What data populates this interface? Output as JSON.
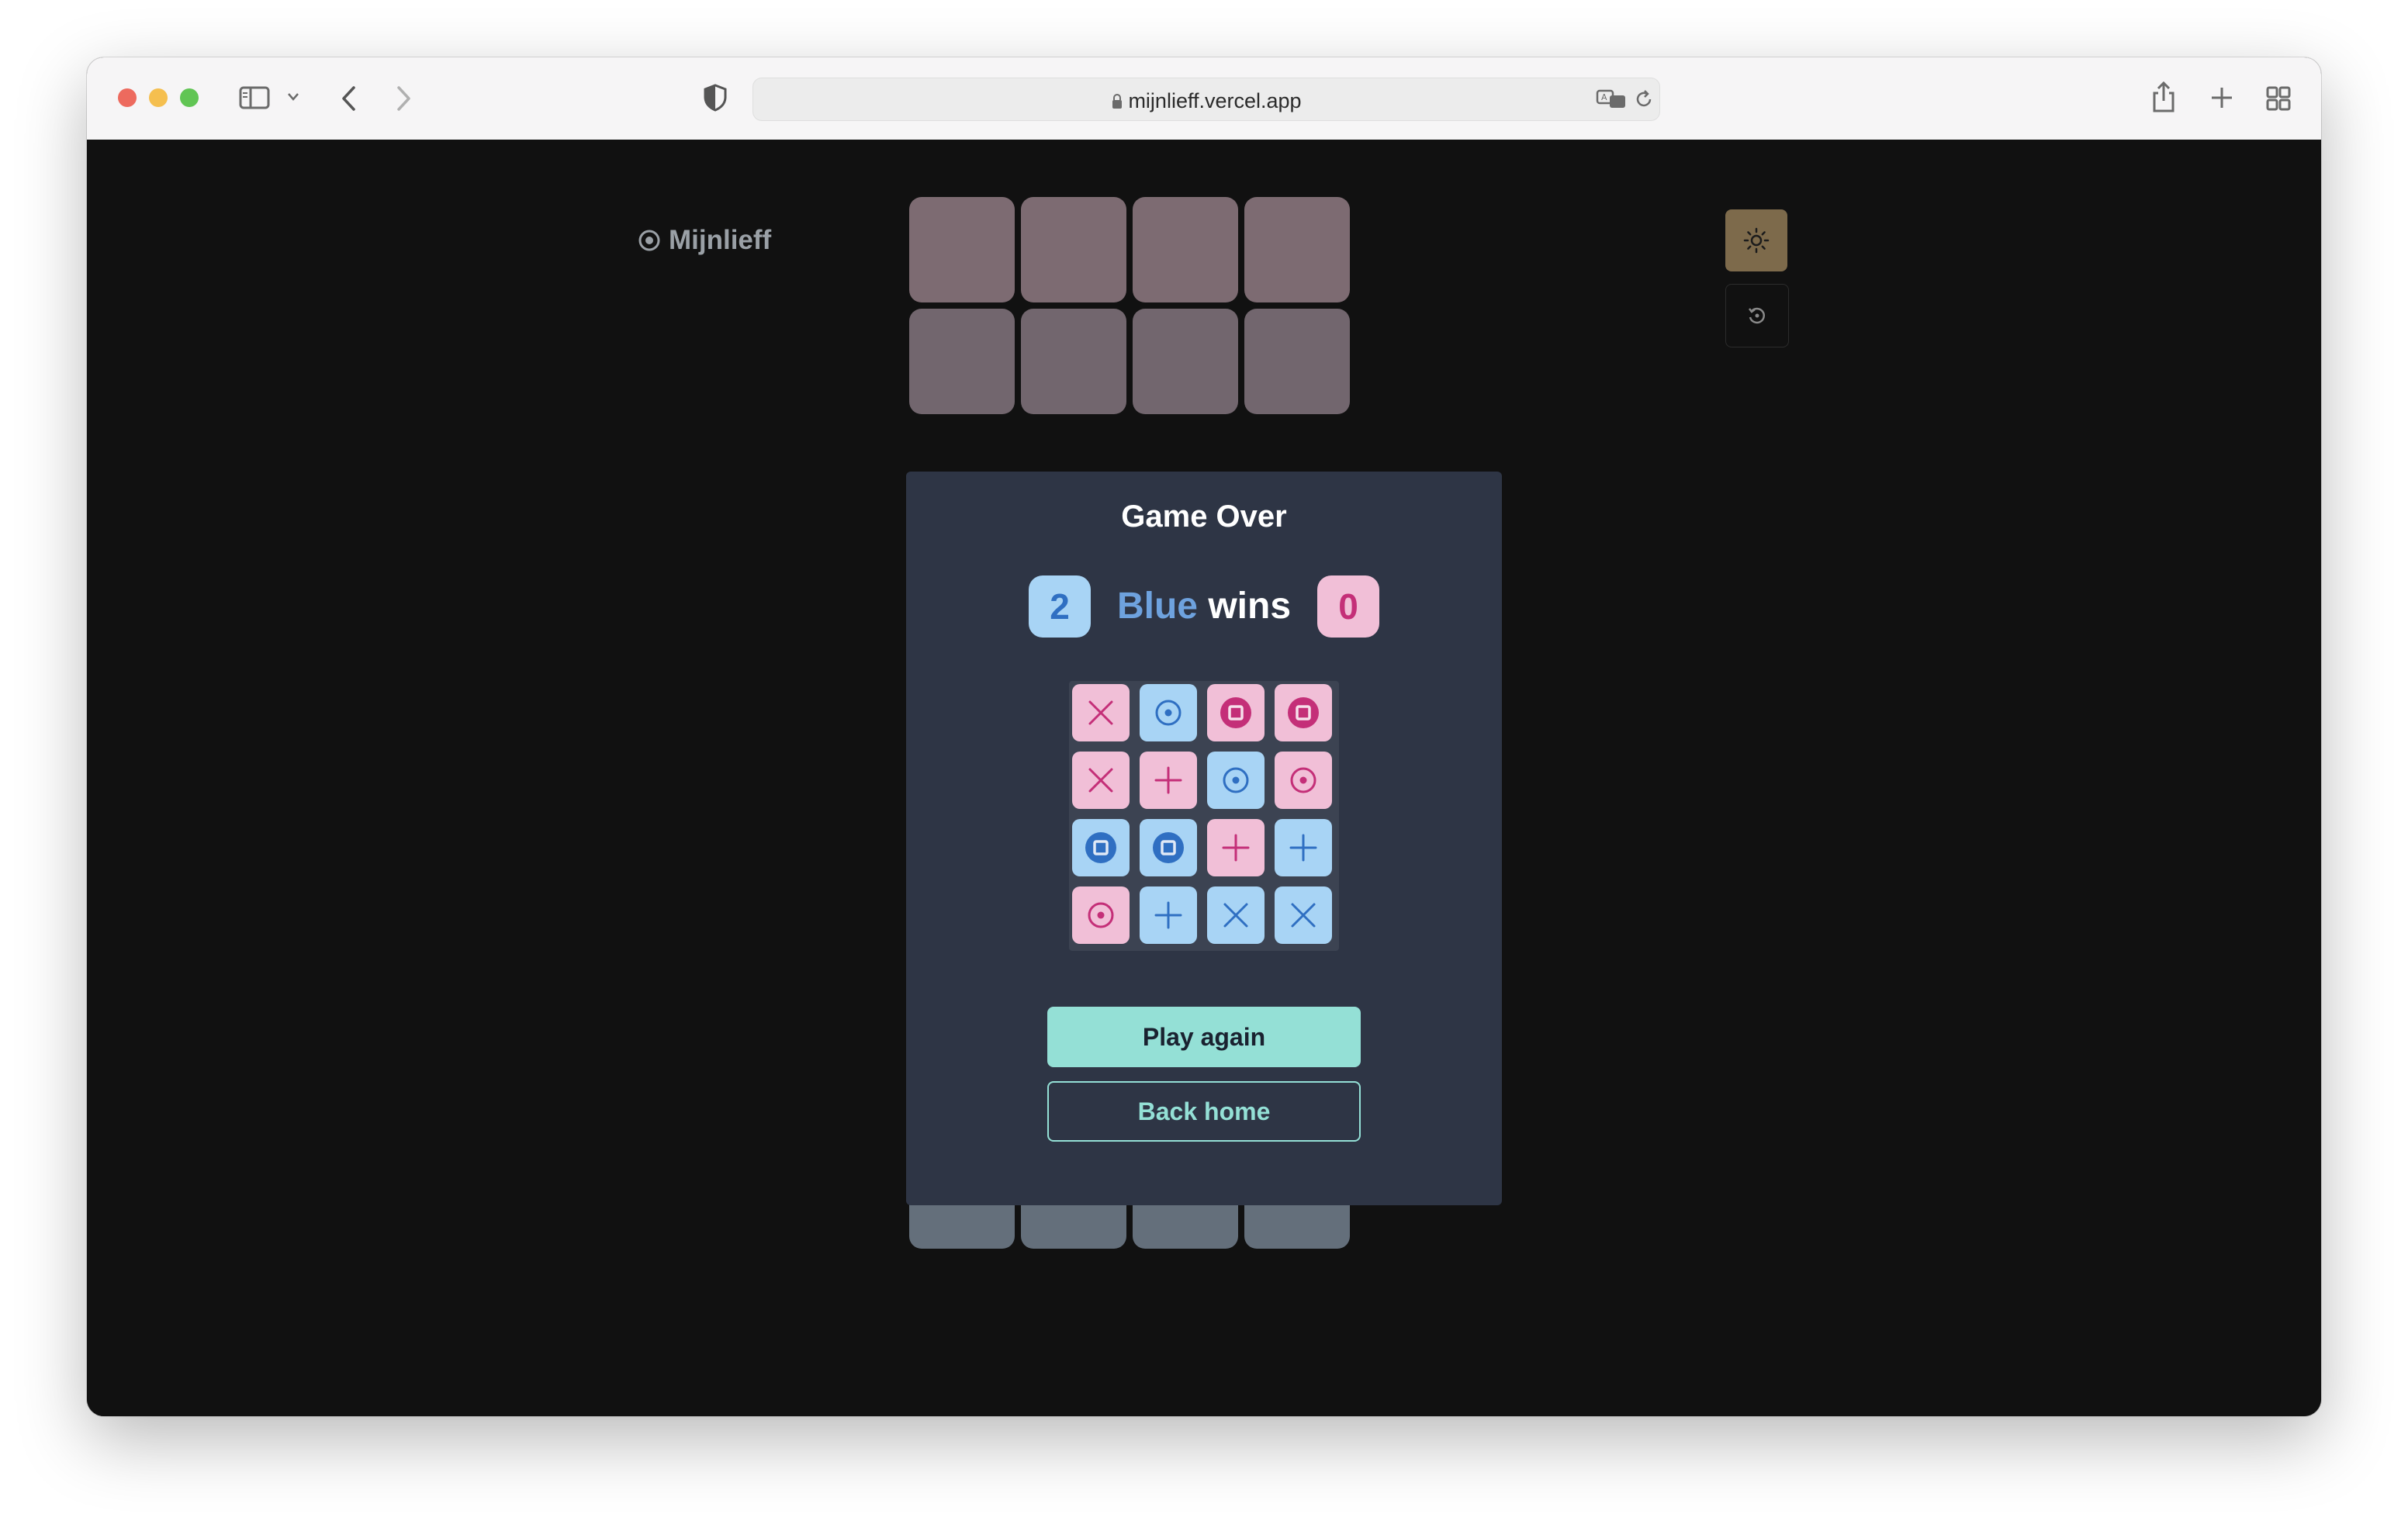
{
  "browser": {
    "url": "mijnlieff.vercel.app"
  },
  "app": {
    "brand": "Mijnlieff"
  },
  "theme": {
    "accent": "#94e0d6",
    "pink": "#f1bfd7",
    "blue": "#a8d4f5",
    "modal_bg": "#2e3545"
  },
  "modal": {
    "title": "Game Over",
    "score_blue": "2",
    "score_pink": "0",
    "winner": "Blue",
    "wins_text": "wins",
    "board": [
      [
        {
          "color": "pink",
          "piece": "cross"
        },
        {
          "color": "blue",
          "piece": "dot"
        },
        {
          "color": "pink",
          "piece": "square"
        },
        {
          "color": "pink",
          "piece": "square"
        }
      ],
      [
        {
          "color": "pink",
          "piece": "cross"
        },
        {
          "color": "pink",
          "piece": "plus"
        },
        {
          "color": "blue",
          "piece": "dot"
        },
        {
          "color": "pink",
          "piece": "dot"
        }
      ],
      [
        {
          "color": "blue",
          "piece": "square"
        },
        {
          "color": "blue",
          "piece": "square"
        },
        {
          "color": "pink",
          "piece": "plus"
        },
        {
          "color": "blue",
          "piece": "plus"
        }
      ],
      [
        {
          "color": "pink",
          "piece": "dot"
        },
        {
          "color": "blue",
          "piece": "plus"
        },
        {
          "color": "blue",
          "piece": "cross"
        },
        {
          "color": "blue",
          "piece": "cross"
        }
      ]
    ],
    "play_again_label": "Play again",
    "back_home_label": "Back home"
  },
  "icons": {
    "theme_toggle": "sun-icon",
    "reset": "rotate-icon",
    "brand": "target-icon"
  }
}
